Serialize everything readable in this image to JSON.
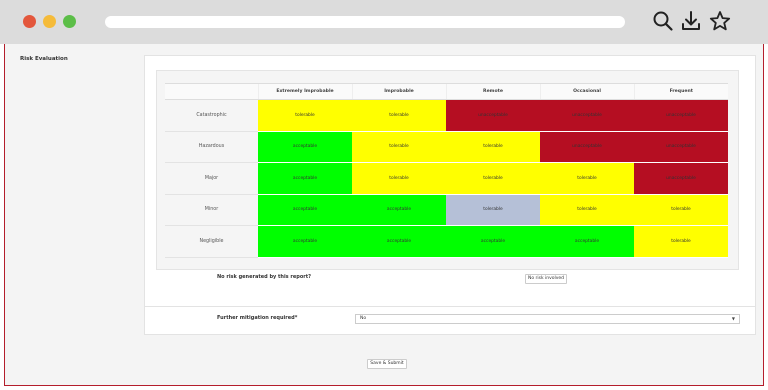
{
  "browser": {
    "icons": [
      "search-icon",
      "download-icon",
      "star-icon"
    ],
    "dot_colors": [
      "#e3573c",
      "#f5bb3a",
      "#5cbe48"
    ]
  },
  "form": {
    "section_label": "Risk Evaluation",
    "matrix": {
      "columns": [
        "Extremely Improbable",
        "Improbable",
        "Remote",
        "Occasional",
        "Frequent"
      ],
      "rows": [
        {
          "label": "Catastrophic",
          "cells": [
            {
              "text": "tolerable",
              "level": "tol"
            },
            {
              "text": "tolerable",
              "level": "tol"
            },
            {
              "text": "unacceptable",
              "level": "unacc"
            },
            {
              "text": "unacceptable",
              "level": "unacc"
            },
            {
              "text": "unacceptable",
              "level": "unacc"
            }
          ]
        },
        {
          "label": "Hazardous",
          "cells": [
            {
              "text": "acceptable",
              "level": "acc"
            },
            {
              "text": "tolerable",
              "level": "tol"
            },
            {
              "text": "tolerable",
              "level": "tol"
            },
            {
              "text": "unacceptable",
              "level": "unacc"
            },
            {
              "text": "unacceptable",
              "level": "unacc"
            }
          ]
        },
        {
          "label": "Major",
          "cells": [
            {
              "text": "acceptable",
              "level": "acc"
            },
            {
              "text": "tolerable",
              "level": "tol"
            },
            {
              "text": "tolerable",
              "level": "tol"
            },
            {
              "text": "tolerable",
              "level": "tol"
            },
            {
              "text": "unacceptable",
              "level": "unacc"
            }
          ]
        },
        {
          "label": "Minor",
          "cells": [
            {
              "text": "acceptable",
              "level": "acc"
            },
            {
              "text": "acceptable",
              "level": "acc"
            },
            {
              "text": "tolerable",
              "level": "grey"
            },
            {
              "text": "tolerable",
              "level": "tol"
            },
            {
              "text": "tolerable",
              "level": "tol"
            }
          ]
        },
        {
          "label": "Negligible",
          "cells": [
            {
              "text": "acceptable",
              "level": "acc"
            },
            {
              "text": "acceptable",
              "level": "acc"
            },
            {
              "text": "acceptable",
              "level": "acc"
            },
            {
              "text": "acceptable",
              "level": "acc"
            },
            {
              "text": "tolerable",
              "level": "tol"
            }
          ]
        }
      ],
      "colors": {
        "tol": "#ffff00",
        "unacc": "#b50e22",
        "acc": "#00ff00",
        "grey": "#b5c0d7"
      }
    },
    "no_risk": {
      "label": "No risk generated by this report?",
      "button": "No risk involved"
    },
    "mitigation": {
      "label": "Further mitigation required*",
      "value": "No",
      "caret": "▼"
    },
    "submit_label": "Save & Submit",
    "accent": "#b41e2c"
  }
}
